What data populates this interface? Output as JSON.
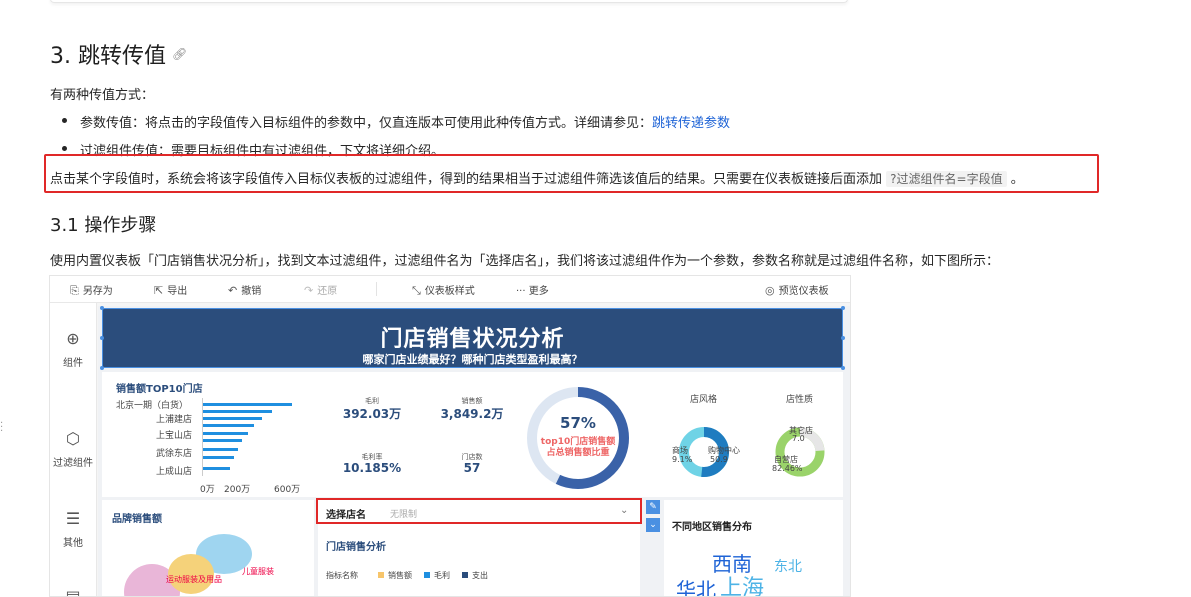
{
  "doc": {
    "heading": "3. 跳转传值",
    "intro": "有两种传值方式：",
    "bullet1_text": "参数传值：将点击的字段值传入目标组件的参数中，仅直连版本可使用此种传值方式。详细请参见：",
    "bullet1_link": "跳转传递参数",
    "bullet2_text": "过滤组件传值：需要目标组件中有过滤组件，下文将详细介绍。",
    "highlight_text": "点击某个字段值时，系统会将该字段值传入目标仪表板的过滤组件，得到的结果相当于过滤组件筛选该值后的结果。只需要在仪表板链接后面添加",
    "highlight_code": "?过滤组件名=字段值",
    "highlight_end": "。",
    "subheading": "3.1 操作步骤",
    "step_text": "使用内置仪表板「门店销售状况分析」，找到文本过滤组件，过滤组件名为「选择店名」，我们将该过滤组件作为一个参数，参数名称就是过滤组件名称，如下图所示："
  },
  "toolbar": {
    "save_as": "另存为",
    "export": "导出",
    "undo": "撤销",
    "redo": "还原",
    "style": "仪表板样式",
    "more": "··· 更多",
    "preview": "预览仪表板"
  },
  "sidebar": {
    "components": "组件",
    "filters": "过滤组件",
    "other": "其他"
  },
  "dashboard": {
    "title": "门店销售状况分析",
    "subtitle": "哪家门店业绩最好？哪种门店类型盈利最高？",
    "top10_title": "销售额TOP10门店",
    "stores": [
      "北京一期（白货）",
      "上浦建店",
      "上宝山店",
      "武徐东店",
      "上成山店"
    ],
    "axis_ticks": [
      "0万",
      "200万",
      "600万"
    ],
    "kpi": [
      {
        "label": "毛利",
        "value": "392.03万"
      },
      {
        "label": "销售额",
        "value": "3,849.2万"
      },
      {
        "label": "毛利率",
        "value": "10.185%"
      },
      {
        "label": "门店数",
        "value": "57"
      }
    ],
    "ring_pct": "57%",
    "ring_label1": "top10门店销售额",
    "ring_label2": "占总销售额比重",
    "style_title": "店风格",
    "style_a": "商场",
    "style_a_pct": "9.1%",
    "style_b": "购物中心",
    "style_b_pct": "50.9",
    "nature_title": "店性质",
    "nature_a": "其它店",
    "nature_a_pct": "7.0",
    "nature_b": "自营店",
    "nature_b_pct": "82.46%",
    "filter_name": "选择店名",
    "filter_placeholder": "无限制",
    "brand_title": "品牌销售额",
    "brand_a": "运动服装及用品",
    "brand_b": "儿童服装",
    "analysis_title": "门店销售分析",
    "legend_label": "指标名称",
    "legend_items": [
      "销售额",
      "毛利",
      "支出"
    ],
    "region_title": "不同地区销售分布",
    "region_words": [
      "西南",
      "东北",
      "华北",
      "上海"
    ]
  },
  "colors": {
    "accent": "#1e63d6",
    "highlight_border": "#e02828",
    "banner": "#2b4d7c",
    "bar": "#1f8fe0"
  }
}
